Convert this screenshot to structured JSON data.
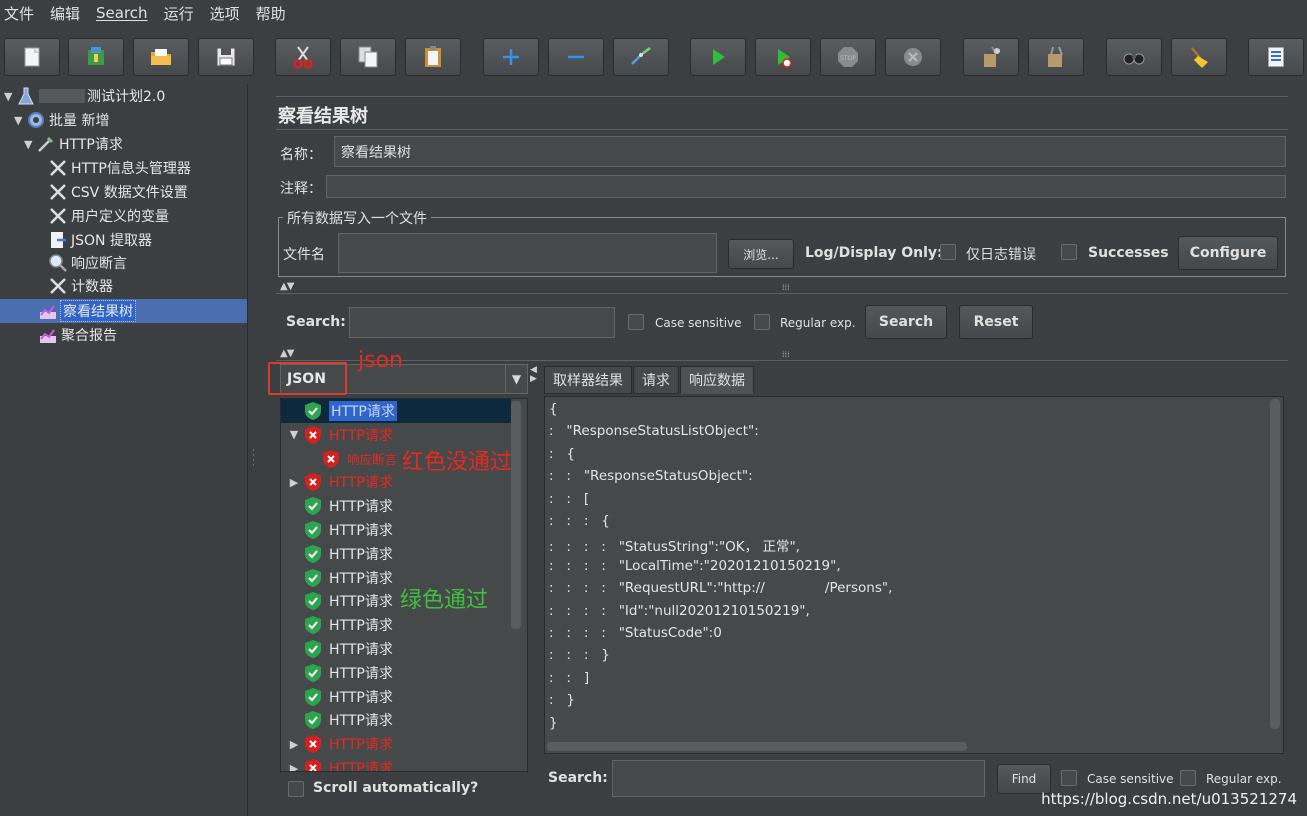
{
  "menu": [
    "文件",
    "编辑",
    "Search",
    "运行",
    "选项",
    "帮助"
  ],
  "toolbar": [
    {
      "name": "new-button",
      "icon": "new-file-icon"
    },
    {
      "name": "templates-button",
      "icon": "templates-icon"
    },
    {
      "name": "open-button",
      "icon": "open-folder-icon"
    },
    {
      "name": "save-button",
      "icon": "save-icon"
    },
    {
      "name": "cut-button",
      "icon": "scissors-icon"
    },
    {
      "name": "copy-button",
      "icon": "copy-icon"
    },
    {
      "name": "paste-button",
      "icon": "paste-icon"
    },
    {
      "name": "expand-button",
      "icon": "plus-icon"
    },
    {
      "name": "collapse-button",
      "icon": "minus-icon"
    },
    {
      "name": "toggle-button",
      "icon": "toggle-icon"
    },
    {
      "name": "start-button",
      "icon": "play-icon"
    },
    {
      "name": "start-no-pause-button",
      "icon": "play-no-timer-icon"
    },
    {
      "name": "stop-button",
      "icon": "stop-icon"
    },
    {
      "name": "shutdown-button",
      "icon": "shutdown-icon"
    },
    {
      "name": "clear-button",
      "icon": "broom-icon"
    },
    {
      "name": "clear-all-button",
      "icon": "broom-all-icon"
    },
    {
      "name": "search-button",
      "icon": "binoculars-icon"
    },
    {
      "name": "reset-search-button",
      "icon": "reset-search-icon"
    },
    {
      "name": "function-helper-button",
      "icon": "list-icon"
    }
  ],
  "tree": [
    {
      "label": "测试计划2.0",
      "level": 0,
      "expanded": true,
      "icon": "test-plan-icon"
    },
    {
      "label": "批量 新增",
      "level": 1,
      "expanded": true,
      "icon": "thread-group-icon"
    },
    {
      "label": "HTTP请求",
      "level": 2,
      "expanded": true,
      "icon": "sampler-icon"
    },
    {
      "label": "HTTP信息头管理器",
      "level": 3,
      "icon": "config-icon"
    },
    {
      "label": "CSV 数据文件设置",
      "level": 3,
      "icon": "config-icon"
    },
    {
      "label": "用户定义的变量",
      "level": 3,
      "icon": "config-icon"
    },
    {
      "label": "JSON 提取器",
      "level": 3,
      "icon": "extractor-icon"
    },
    {
      "label": "响应断言",
      "level": 3,
      "icon": "assertion-icon"
    },
    {
      "label": "计数器",
      "level": 3,
      "icon": "config-icon"
    },
    {
      "label": "察看结果树",
      "level": 2,
      "icon": "listener-icon",
      "selected": true
    },
    {
      "label": "聚合报告",
      "level": 2,
      "icon": "listener-icon"
    }
  ],
  "panel": {
    "title": "察看结果树",
    "name_label": "名称：",
    "name_value": "察看结果树",
    "comment_label": "注释：",
    "comment_value": "",
    "fileset_legend": "所有数据写入一个文件",
    "filename_label": "文件名",
    "filename_value": "",
    "browse_label": "浏览...",
    "logdisplay_label": "Log/Display Only:",
    "errors_label": "仅日志错误",
    "successes_label": "Successes",
    "configure_label": "Configure",
    "search_label": "Search:",
    "search_value": "",
    "case_label": "Case sensitive",
    "regex_label": "Regular exp.",
    "search_btn": "Search",
    "reset_btn": "Reset"
  },
  "renderer": {
    "selected": "JSON"
  },
  "results": [
    {
      "label": "HTTP请求",
      "status": "ok",
      "selected": true,
      "arrow": ""
    },
    {
      "label": "HTTP请求",
      "status": "fail",
      "arrow": "down"
    },
    {
      "label": "响应断言",
      "status": "fail",
      "child": true,
      "arrow": ""
    },
    {
      "label": "HTTP请求",
      "status": "fail",
      "arrow": "right"
    },
    {
      "label": "HTTP请求",
      "status": "ok",
      "arrow": ""
    },
    {
      "label": "HTTP请求",
      "status": "ok",
      "arrow": ""
    },
    {
      "label": "HTTP请求",
      "status": "ok",
      "arrow": ""
    },
    {
      "label": "HTTP请求",
      "status": "ok",
      "arrow": ""
    },
    {
      "label": "HTTP请求",
      "status": "ok",
      "arrow": ""
    },
    {
      "label": "HTTP请求",
      "status": "ok",
      "arrow": ""
    },
    {
      "label": "HTTP请求",
      "status": "ok",
      "arrow": ""
    },
    {
      "label": "HTTP请求",
      "status": "ok",
      "arrow": ""
    },
    {
      "label": "HTTP请求",
      "status": "ok",
      "arrow": ""
    },
    {
      "label": "HTTP请求",
      "status": "ok",
      "arrow": ""
    },
    {
      "label": "HTTP请求",
      "status": "fail",
      "arrow": "right"
    },
    {
      "label": "HTTP请求",
      "status": "fail",
      "arrow": "right"
    }
  ],
  "scroll_auto_label": "Scroll automatically?",
  "tabs": [
    "取样器结果",
    "请求",
    "响应数据"
  ],
  "active_tab": 2,
  "response_lines": [
    "{",
    ":   \"ResponseStatusListObject\":",
    ":   {",
    ":   :   \"ResponseStatusObject\":",
    ":   :   [",
    ":   :   :   {",
    ":   :   :   :   \"StatusString\":\"OK， 正常\",",
    ":   :   :   :   \"LocalTime\":\"20201210150219\",",
    ":   :   :   :   \"RequestURL\":\"http://              /Persons\",",
    ":   :   :   :   \"Id\":\"null20201210150219\",",
    ":   :   :   :   \"StatusCode\":0",
    ":   :   :   }",
    ":   :   ]",
    ":   }",
    "}"
  ],
  "find": {
    "search_label": "Search:",
    "value": "",
    "find_btn": "Find",
    "case_label": "Case sensitive",
    "regex_label": "Regular exp."
  },
  "annotations": {
    "json": "json",
    "red": "红色没通过",
    "green": "绿色通过"
  },
  "watermark": "https://blog.csdn.net/u013521274",
  "colors": {
    "fail": "#e8281e",
    "pass_annotation": "#3fbf3f",
    "selection": "#4b6eaf"
  }
}
